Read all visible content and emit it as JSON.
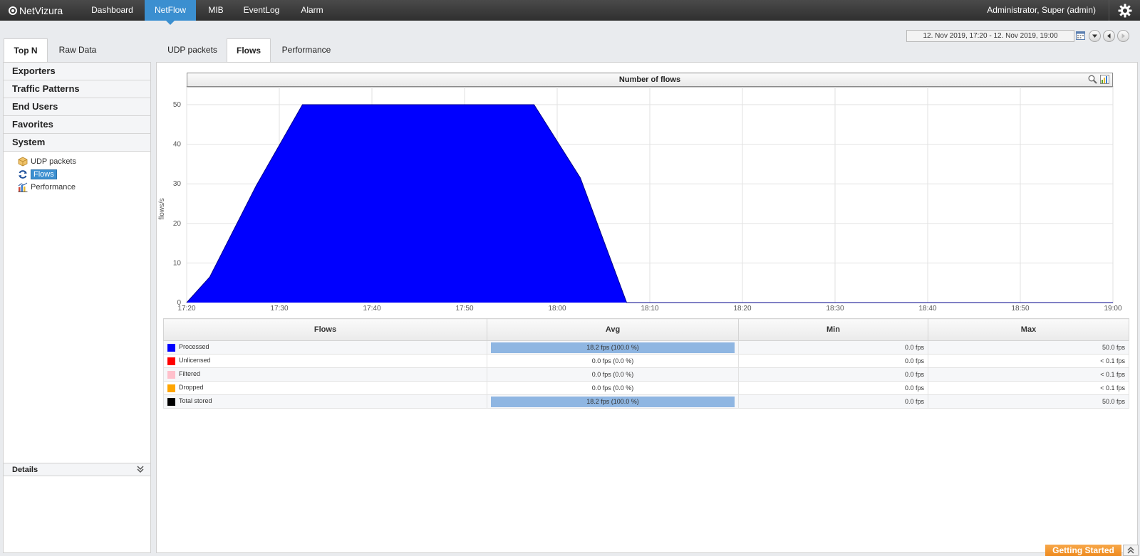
{
  "app": {
    "logo_text": "NetVizura"
  },
  "nav": {
    "items": [
      {
        "label": "Dashboard"
      },
      {
        "label": "NetFlow",
        "active": true
      },
      {
        "label": "MIB"
      },
      {
        "label": "EventLog"
      },
      {
        "label": "Alarm"
      }
    ],
    "user_label": "Administrator, Super (admin)"
  },
  "date_range": {
    "value": "12. Nov 2019, 17:20 - 12. Nov 2019, 19:00"
  },
  "left_tabs": [
    {
      "label": "Top N",
      "active": true
    },
    {
      "label": "Raw Data"
    }
  ],
  "main_tabs": [
    {
      "label": "UDP packets"
    },
    {
      "label": "Flows",
      "active": true
    },
    {
      "label": "Performance"
    }
  ],
  "sidebar": {
    "sections": [
      "Exporters",
      "Traffic Patterns",
      "End Users",
      "Favorites",
      "System"
    ],
    "system_items": [
      {
        "label": "UDP packets",
        "icon": "package-icon"
      },
      {
        "label": "Flows",
        "icon": "refresh-icon",
        "selected": true
      },
      {
        "label": "Performance",
        "icon": "performance-chart-icon"
      }
    ],
    "details_label": "Details"
  },
  "chart_data": {
    "type": "area",
    "title": "Number of flows",
    "xlabel": "",
    "ylabel": "flows/s",
    "x_ticks": [
      "17:20",
      "17:30",
      "17:40",
      "17:50",
      "18:00",
      "18:10",
      "18:20",
      "18:30",
      "18:40",
      "18:50",
      "19:00"
    ],
    "y_ticks": [
      "0",
      "10",
      "20",
      "30",
      "40",
      "50"
    ],
    "xlim": [
      "17:20",
      "19:00"
    ],
    "ylim": [
      0,
      52
    ],
    "grid": true,
    "series": [
      {
        "color": "#0000ff",
        "x": [
          "17:20",
          "17:22.5",
          "17:27.5",
          "17:32.5",
          "17:57.5",
          "18:02.5",
          "18:07.5",
          "18:10",
          "19:00"
        ],
        "values": [
          0,
          6.5,
          29.5,
          50,
          50,
          31.5,
          0,
          0,
          0
        ]
      }
    ]
  },
  "stats_table": {
    "headers": [
      "Flows",
      "Avg",
      "Min",
      "Max"
    ],
    "rows": [
      {
        "name": "Processed",
        "color": "#0000ff",
        "avg": "18.2 fps (100.0 %)",
        "avg_bar": 1.0,
        "min": "0.0 fps",
        "max": "50.0 fps"
      },
      {
        "name": "Unlicensed",
        "color": "#ff0000",
        "avg": "0.0 fps (0.0 %)",
        "avg_bar": 0,
        "min": "0.0 fps",
        "max": "< 0.1 fps"
      },
      {
        "name": "Filtered",
        "color": "#ffc0cb",
        "avg": "0.0 fps (0.0 %)",
        "avg_bar": 0,
        "min": "0.0 fps",
        "max": "< 0.1 fps"
      },
      {
        "name": "Dropped",
        "color": "#ffa500",
        "avg": "0.0 fps (0.0 %)",
        "avg_bar": 0,
        "min": "0.0 fps",
        "max": "< 0.1 fps"
      },
      {
        "name": "Total stored",
        "color": "#000000",
        "avg": "18.2 fps (100.0 %)",
        "avg_bar": 1.0,
        "min": "0.0 fps",
        "max": "50.0 fps"
      }
    ]
  },
  "footer": {
    "getting_started": "Getting Started"
  }
}
